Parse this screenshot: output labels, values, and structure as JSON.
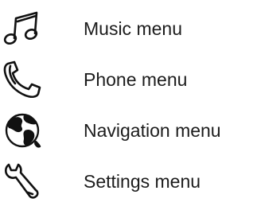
{
  "menu": {
    "items": [
      {
        "label": "Music menu",
        "icon": "music-note-icon"
      },
      {
        "label": "Phone menu",
        "icon": "phone-handset-icon"
      },
      {
        "label": "Navigation menu",
        "icon": "globe-icon"
      },
      {
        "label": "Settings menu",
        "icon": "wrench-icon"
      }
    ]
  }
}
